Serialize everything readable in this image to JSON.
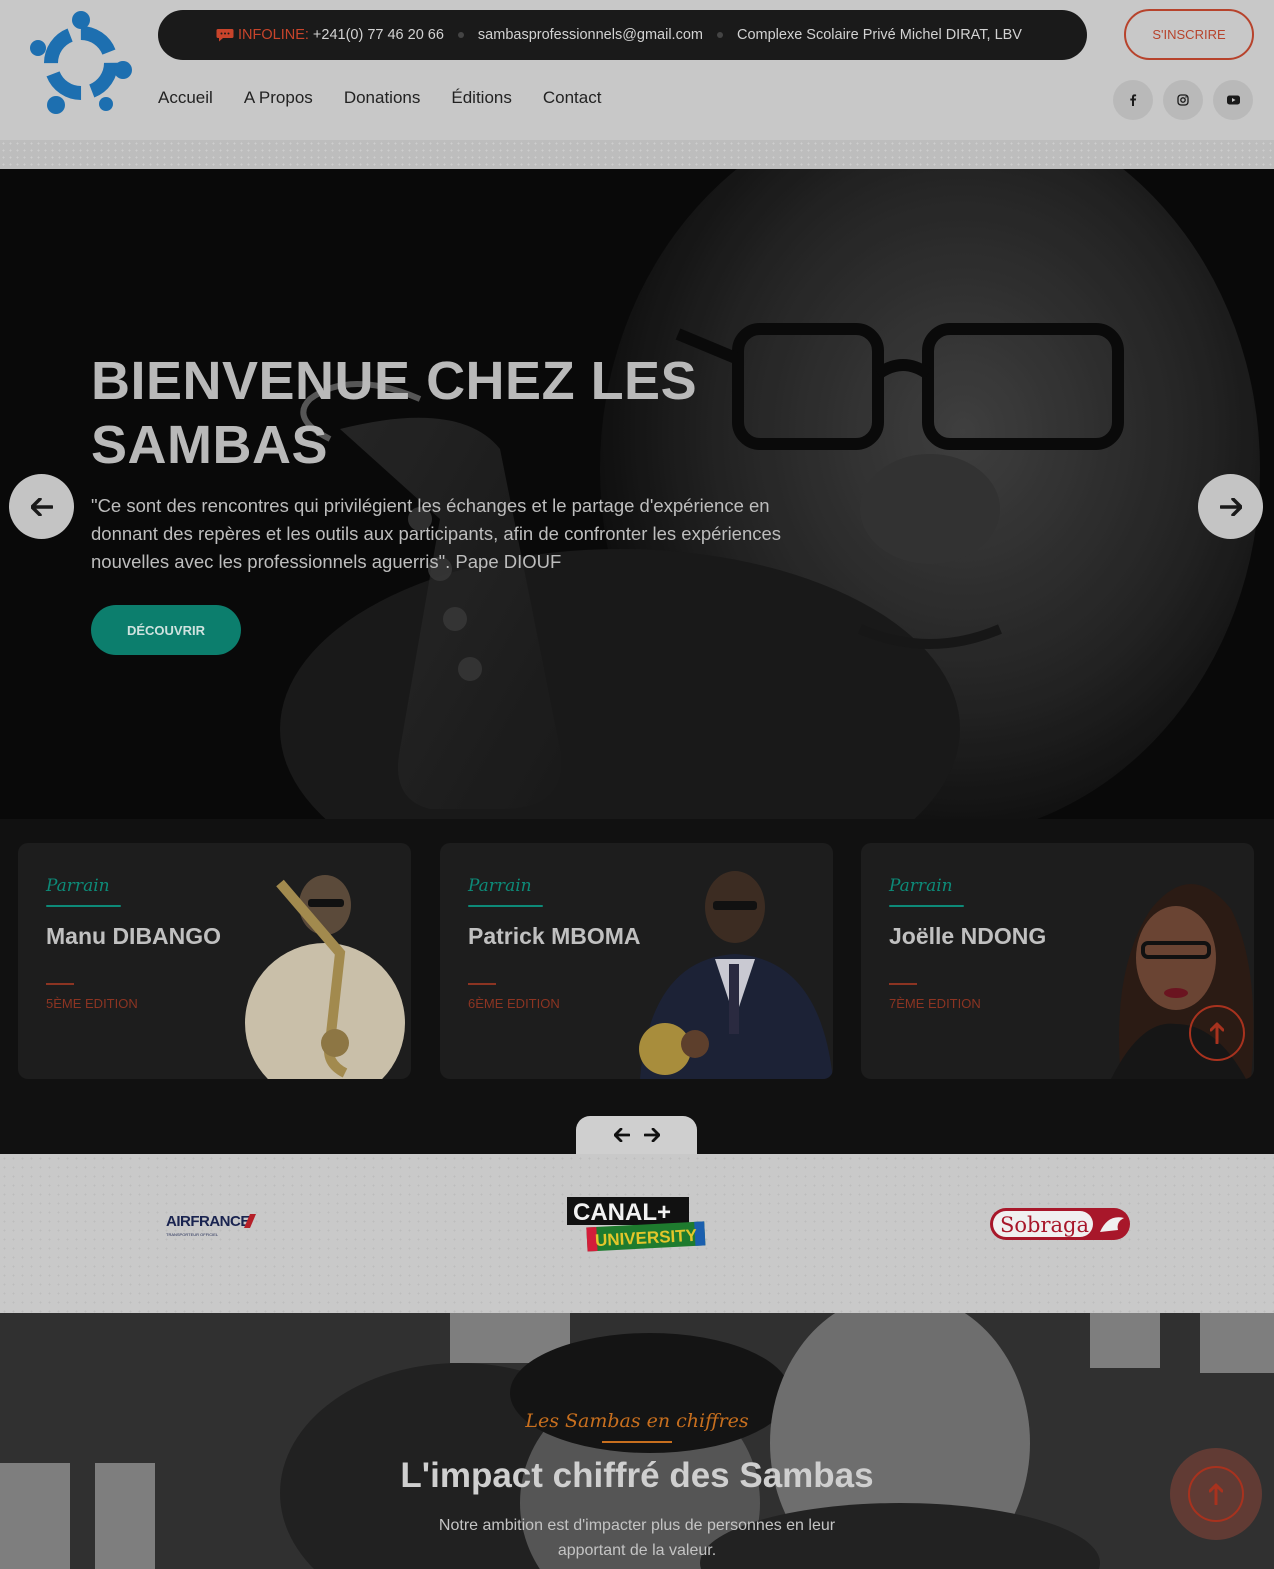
{
  "header": {
    "infoline_label": "INFOLINE:",
    "infoline_phone": "+241(0) 77 46 20 66",
    "email": "sambasprofessionnels@gmail.com",
    "address": "Complexe Scolaire Privé Michel DIRAT, LBV",
    "signup_label": "S'INSCRIRE",
    "nav": [
      "Accueil",
      "A Propos",
      "Donations",
      "Éditions",
      "Contact"
    ],
    "socials": [
      "facebook-icon",
      "instagram-icon",
      "youtube-icon"
    ]
  },
  "hero": {
    "title": "BIENVENUE CHEZ LES SAMBAS",
    "quote": "\"Ce sont des rencontres qui privilégient les échanges et le partage d'expérience en donnant des repères et les outils aux participants, afin de confronter les expériences nouvelles avec les professionnels aguerris\". Pape DIOUF",
    "cta_label": "DÉCOUVRIR"
  },
  "cards": [
    {
      "tag": "Parrain",
      "name": "Manu DIBANGO",
      "edition": "5ÈME EDITION"
    },
    {
      "tag": "Parrain",
      "name": "Patrick MBOMA",
      "edition": "6ÈME EDITION"
    },
    {
      "tag": "Parrain",
      "name": "Joëlle NDONG",
      "edition": "7ÈME EDITION"
    }
  ],
  "partners": {
    "airfrance": "AIRFRANCE",
    "airfrance_sub": "TRANSPORTEUR OFFICIEL",
    "canal_top": "CANAL+",
    "canal_bottom": "UNIVERSITY",
    "sobraga": "Sobraga"
  },
  "stats": {
    "kicker": "Les Sambas en chiffres",
    "title": "L'impact chiffré des Sambas",
    "text": "Notre ambition est d'impacter plus de personnes en leur apportant de la valeur."
  },
  "colors": {
    "accent_red": "#b7432c",
    "accent_teal": "#0c7e6d",
    "kicker_orange": "#c86f1e",
    "logo_blue": "#1d6fb0"
  }
}
